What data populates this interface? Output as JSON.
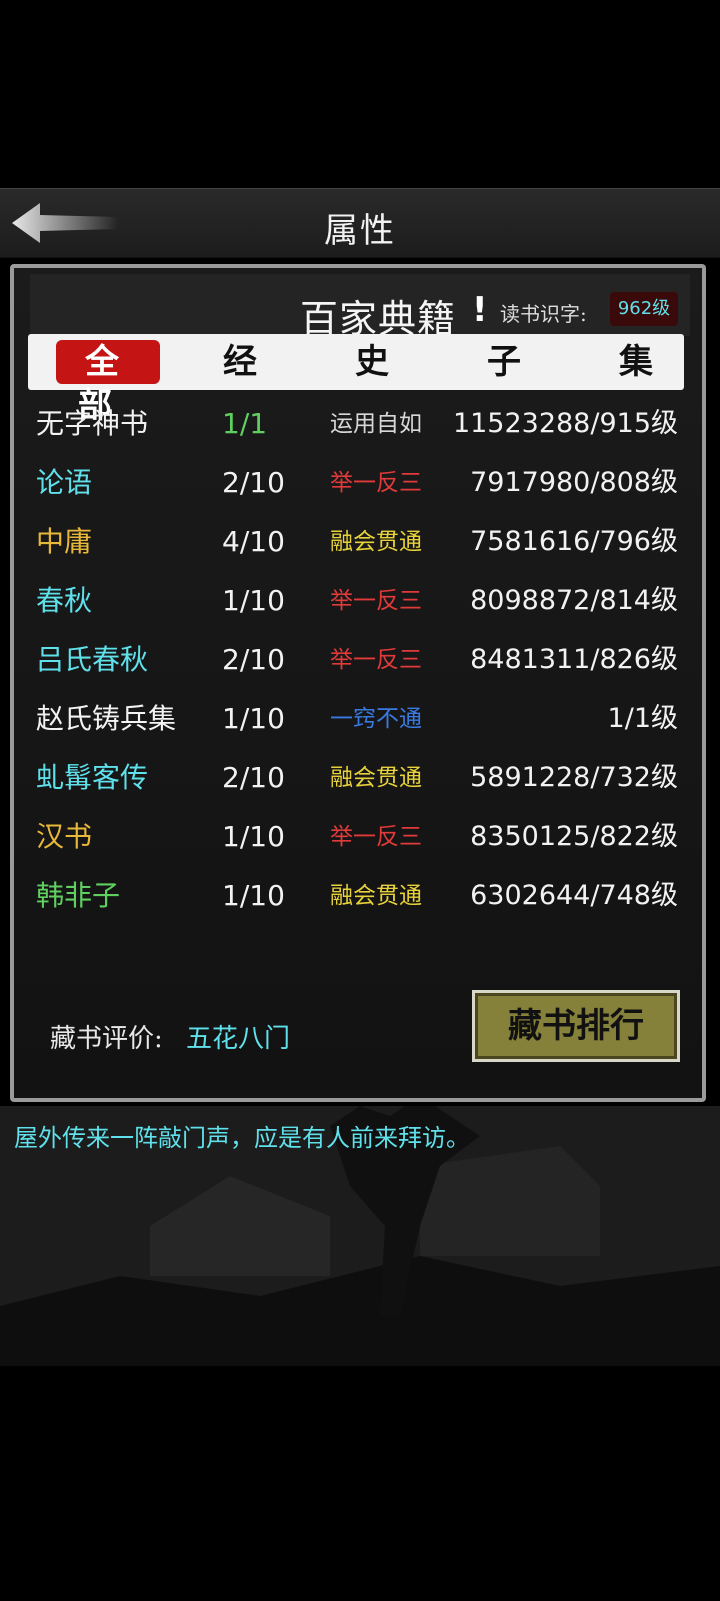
{
  "header": {
    "title": "属性",
    "back_icon": "back-arrow-icon"
  },
  "panel": {
    "title": "百家典籍",
    "exclamation": "!",
    "level_label": "读书识字:",
    "level_value": "962级"
  },
  "tabs": [
    {
      "label": "全部",
      "active": true
    },
    {
      "label": "经",
      "active": false
    },
    {
      "label": "史",
      "active": false
    },
    {
      "label": "子",
      "active": false
    },
    {
      "label": "集",
      "active": false
    }
  ],
  "books": [
    {
      "name": "无字神书",
      "name_color": "#f2f2f2",
      "count": "1/1",
      "count_color": "#5fcf5f",
      "mastery": "运用自如",
      "mastery_color": "#d8d8d8",
      "progress": "11523288/915级"
    },
    {
      "name": "论语",
      "name_color": "#5fe0ea",
      "count": "2/10",
      "count_color": "#f2f2f2",
      "mastery": "举一反三",
      "mastery_color": "#e03a3a",
      "progress": "7917980/808级"
    },
    {
      "name": "中庸",
      "name_color": "#e8b83a",
      "count": "4/10",
      "count_color": "#f2f2f2",
      "mastery": "融会贯通",
      "mastery_color": "#e8d23a",
      "progress": "7581616/796级"
    },
    {
      "name": "春秋",
      "name_color": "#5fe0ea",
      "count": "1/10",
      "count_color": "#f2f2f2",
      "mastery": "举一反三",
      "mastery_color": "#e03a3a",
      "progress": "8098872/814级"
    },
    {
      "name": "吕氏春秋",
      "name_color": "#5fe0ea",
      "count": "2/10",
      "count_color": "#f2f2f2",
      "mastery": "举一反三",
      "mastery_color": "#e03a3a",
      "progress": "8481311/826级"
    },
    {
      "name": "赵氏铸兵集",
      "name_color": "#f2f2f2",
      "count": "1/10",
      "count_color": "#f2f2f2",
      "mastery": "一窍不通",
      "mastery_color": "#3a7ae0",
      "progress": "1/1级"
    },
    {
      "name": "虬髯客传",
      "name_color": "#5fe0ea",
      "count": "2/10",
      "count_color": "#f2f2f2",
      "mastery": "融会贯通",
      "mastery_color": "#e8d23a",
      "progress": "5891228/732级"
    },
    {
      "name": "汉书",
      "name_color": "#e8b83a",
      "count": "1/10",
      "count_color": "#f2f2f2",
      "mastery": "举一反三",
      "mastery_color": "#e03a3a",
      "progress": "8350125/822级"
    },
    {
      "name": "韩非子",
      "name_color": "#5fcf5f",
      "count": "1/10",
      "count_color": "#f2f2f2",
      "mastery": "融会贯通",
      "mastery_color": "#e8d23a",
      "progress": "6302644/748级"
    }
  ],
  "footer": {
    "rating_label": "藏书评价:",
    "rating_value": "五花八门",
    "rank_button": "藏书排行"
  },
  "message": "屋外传来一阵敲门声，应是有人前来拜访。"
}
